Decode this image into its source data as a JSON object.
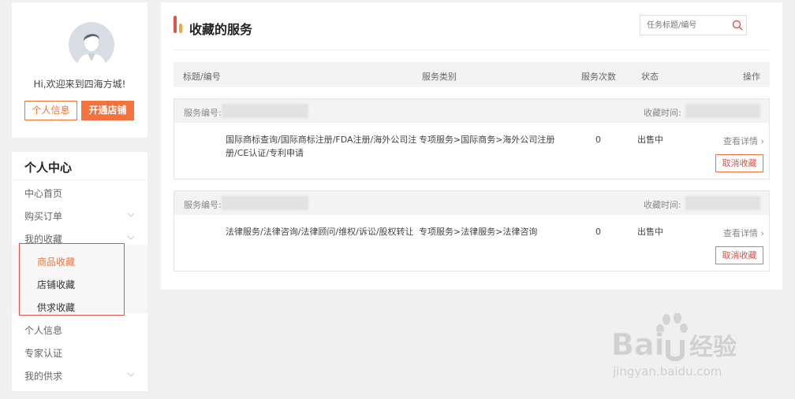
{
  "profile": {
    "greeting": "Hi,欢迎来到四海方城!",
    "info_button": "个人信息",
    "open_shop_button": "开通店铺"
  },
  "menu": {
    "title": "个人中心",
    "items": [
      {
        "label": "中心首页"
      },
      {
        "label": "购买订单"
      },
      {
        "label": "我的收藏"
      },
      {
        "label": "个人信息"
      },
      {
        "label": "专家认证"
      },
      {
        "label": "我的供求"
      }
    ],
    "sub_items": [
      {
        "label": "商品收藏",
        "active": true
      },
      {
        "label": "店铺收藏",
        "active": false
      },
      {
        "label": "供求收藏",
        "active": false
      }
    ]
  },
  "main": {
    "title": "收藏的服务",
    "search_placeholder": "任务标题/编号",
    "columns": [
      "标题/编号",
      "服务类别",
      "服务次数",
      "状态",
      "操作"
    ],
    "service_no_label": "服务编号:",
    "fav_time_label": "收藏时间:",
    "rows": [
      {
        "title_line1": "国际商标查询/国际商标注册/FDA注册/海外公司注",
        "title_line2": "册/CE认证/专利申请",
        "category": "专项服务>国际商务>海外公司注册",
        "count": "0",
        "status": "出售中",
        "detail": "查看详情",
        "cancel": "取消收藏"
      },
      {
        "title_line1": "法律服务/法律咨询/法律顾问/维权/诉讼/股权转让",
        "title_line2": "",
        "category": "专项服务>法律服务>法律咨询",
        "count": "0",
        "status": "出售中",
        "detail": "查看详情",
        "cancel": "取消收藏"
      }
    ]
  },
  "watermark": {
    "brand": "Bai",
    "brand_suffix": "经验",
    "url": "jingyan.baidu.com"
  },
  "colors": {
    "accent": "#f4733c",
    "highlight_box": "#e0524a",
    "active_sub": "#f4733c"
  }
}
